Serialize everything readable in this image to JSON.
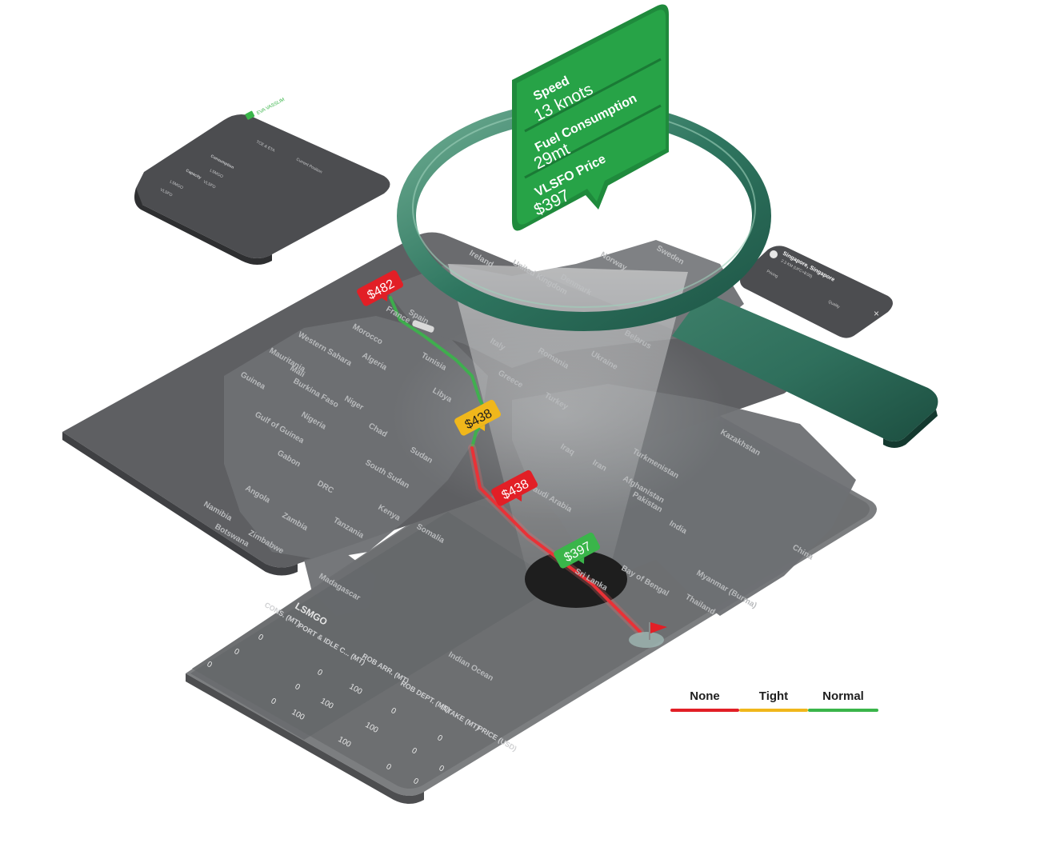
{
  "colors": {
    "none": "#e21f26",
    "tight": "#f0b71b",
    "normal": "#3ab54a",
    "callout_green": "#27a347",
    "map_dark": "#5b5c60"
  },
  "callout": {
    "speed_label": "Speed",
    "speed_value": "13 knots",
    "fuel_label": "Fuel Consumption",
    "fuel_value": "29mt",
    "price_label": "VLSFO Price",
    "price_value": "$397"
  },
  "price_tags": [
    {
      "label": "$482",
      "status": "none"
    },
    {
      "label": "$438",
      "status": "tight"
    },
    {
      "label": "$438",
      "status": "none"
    },
    {
      "label": "$397",
      "status": "normal"
    }
  ],
  "port_panel": {
    "title": "Singapore, Singapore",
    "sub": "2.3 KM (UFC+8:00)",
    "tab": "Pricing",
    "field": "Quality"
  },
  "vessel_card": {
    "title": "EVA VASSLIM",
    "tabs": [
      "Consumption",
      "TCE & ETA",
      "Current Position"
    ],
    "capacity": "Capacity",
    "rows": [
      "LSMGO",
      "VLSFO",
      "LSMGO",
      "VLSFO"
    ]
  },
  "map_labels": {
    "europe": [
      "Ireland",
      "United Kingdom",
      "Denmark",
      "Norway",
      "Sweden",
      "Spain",
      "France",
      "Italy",
      "Romania",
      "Ukraine",
      "Greece",
      "Turkey",
      "Belarus"
    ],
    "africa": [
      "Morocco",
      "Western Sahara",
      "Mauritania",
      "Mali",
      "Algeria",
      "Tunisia",
      "Libya",
      "Niger",
      "Chad",
      "Nigeria",
      "Burkina Faso",
      "Guinea",
      "Gabon",
      "DRC",
      "Angola",
      "Namibia",
      "Botswana",
      "Zambia",
      "Zimbabwe",
      "Tanzania",
      "Kenya",
      "Sudan",
      "South Sudan",
      "Gulf of Guinea"
    ],
    "asia": [
      "Kazakhstan",
      "Turkmenistan",
      "Afghanistan",
      "Pakistan",
      "Iran",
      "Iraq",
      "Saudi Arabia",
      "India",
      "China",
      "Myanmar (Burma)",
      "Thailand",
      "Bay of Bengal",
      "Sri Lanka",
      "Somalia",
      "Madagascar",
      "Indian Ocean"
    ]
  },
  "table": {
    "fuel": "LSMGO",
    "columns": [
      "CONS. (MT)",
      "PORT & IDLE C... (MT)",
      "ROB ARR. (MT)",
      "ROB DEPT. (MT)",
      "INTAKE (MT)",
      "PRICE (USD)"
    ],
    "row1": [
      "0",
      "0",
      "0",
      "100",
      "0",
      "0"
    ],
    "row2": [
      "0",
      "0",
      "100",
      "100",
      "0",
      "0"
    ],
    "row3": [
      "0",
      "100",
      "100",
      "0",
      "0",
      "0"
    ]
  },
  "legend": [
    {
      "label": "None",
      "status": "none"
    },
    {
      "label": "Tight",
      "status": "tight"
    },
    {
      "label": "Normal",
      "status": "normal"
    }
  ]
}
